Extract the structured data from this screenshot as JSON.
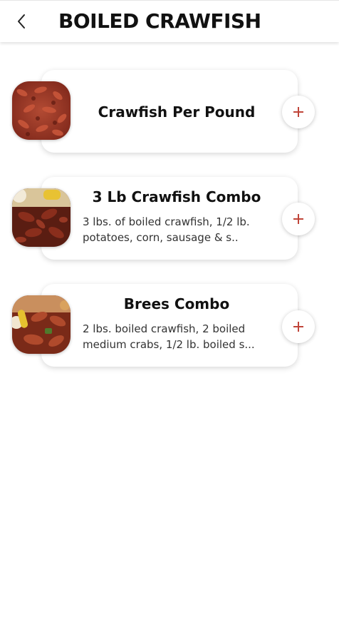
{
  "header": {
    "title": "BOILED CRAWFISH",
    "back_icon": "chevron-left-icon"
  },
  "colors": {
    "accent": "#c0453a",
    "title_text": "#111111",
    "body_text": "#333333"
  },
  "items": [
    {
      "name": "Crawfish Per Pound",
      "description": "",
      "add_icon": "plus-icon"
    },
    {
      "name": "3 Lb Crawfish Combo",
      "description": "3 lbs. of boiled crawfish, 1/2 lb. potatoes, corn, sausage & s..",
      "add_icon": "plus-icon"
    },
    {
      "name": "Brees Combo",
      "description": "2 lbs. boiled crawfish, 2 boiled medium crabs, 1/2 lb. boiled s...",
      "add_icon": "plus-icon"
    }
  ]
}
